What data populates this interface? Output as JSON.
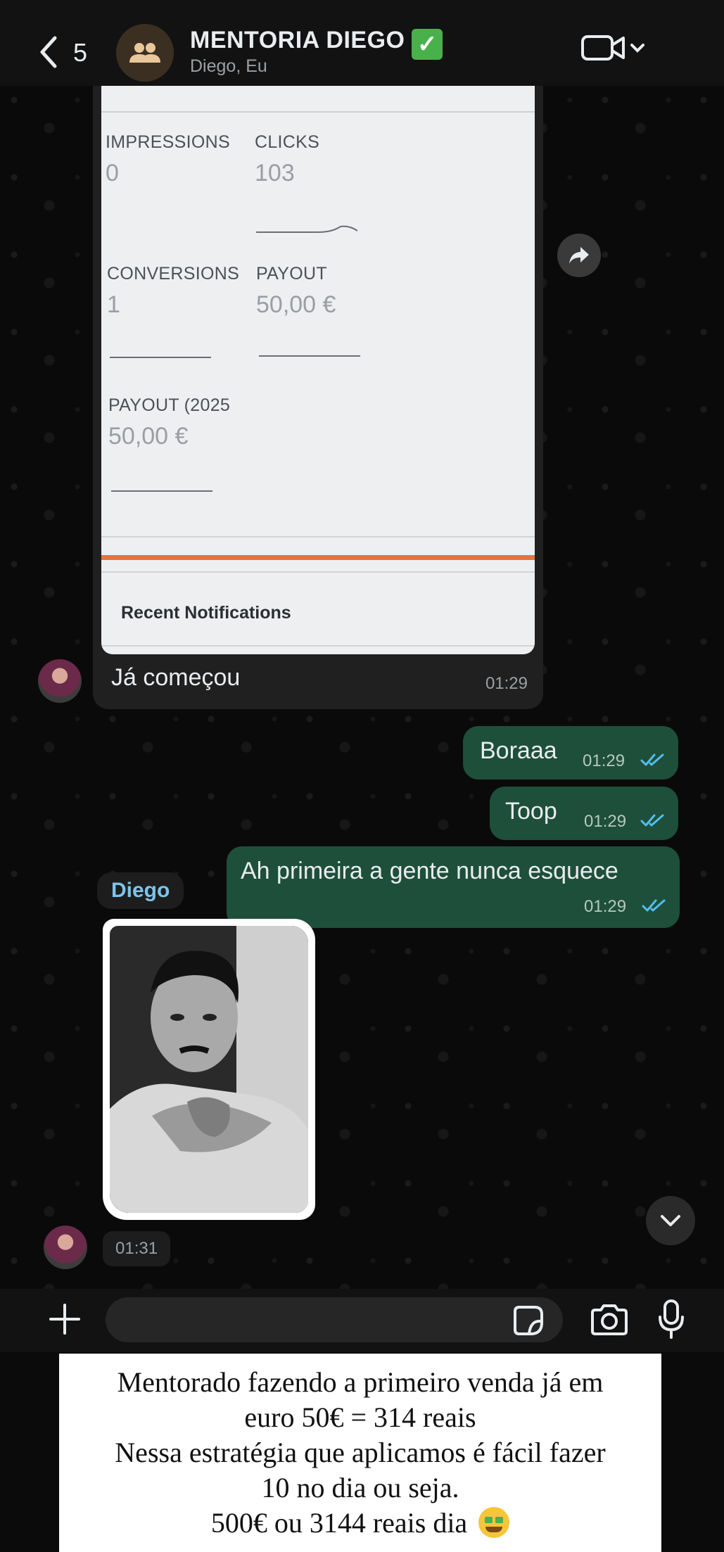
{
  "header": {
    "back_count": "5",
    "title": "MENTORIA DIEGO",
    "title_emoji": "✅",
    "subtitle": "Diego, Eu"
  },
  "screenshot": {
    "metrics": [
      {
        "label": "IMPRESSIONS",
        "value": "0"
      },
      {
        "label": "CLICKS",
        "value": "103"
      },
      {
        "label": "CONVERSIONS",
        "value": "1"
      },
      {
        "label": "PAYOUT",
        "value": "50,00 €"
      },
      {
        "label": "PAYOUT (2025",
        "value": "50,00 €"
      }
    ],
    "notifications_title": "Recent Notifications"
  },
  "messages": {
    "incoming_1": {
      "text": "Já começou",
      "time": "01:29"
    },
    "outgoing": [
      {
        "text": "Boraaa",
        "time": "01:29"
      },
      {
        "text": "Toop",
        "time": "01:29"
      },
      {
        "text": "Ah primeira a gente nunca esquece",
        "time": "01:29"
      }
    ],
    "sticker_sender": "Diego",
    "sticker_time": "01:31"
  },
  "caption": {
    "lines": [
      "Mentorado fazendo a primeiro venda já em",
      "euro 50€ = 314 reais",
      "Nessa estratégia que aplicamos é fácil fazer",
      "10 no dia ou seja.",
      "500€ ou 3144 reais dia"
    ],
    "emoji": "money-mouth-face"
  },
  "colors": {
    "outgoing_bubble": "#1e4f3b",
    "incoming_bubble": "#202020",
    "sender_name": "#7cc4ea",
    "orange_rule": "#e5743d",
    "read_ticks": "#53bdeb"
  }
}
